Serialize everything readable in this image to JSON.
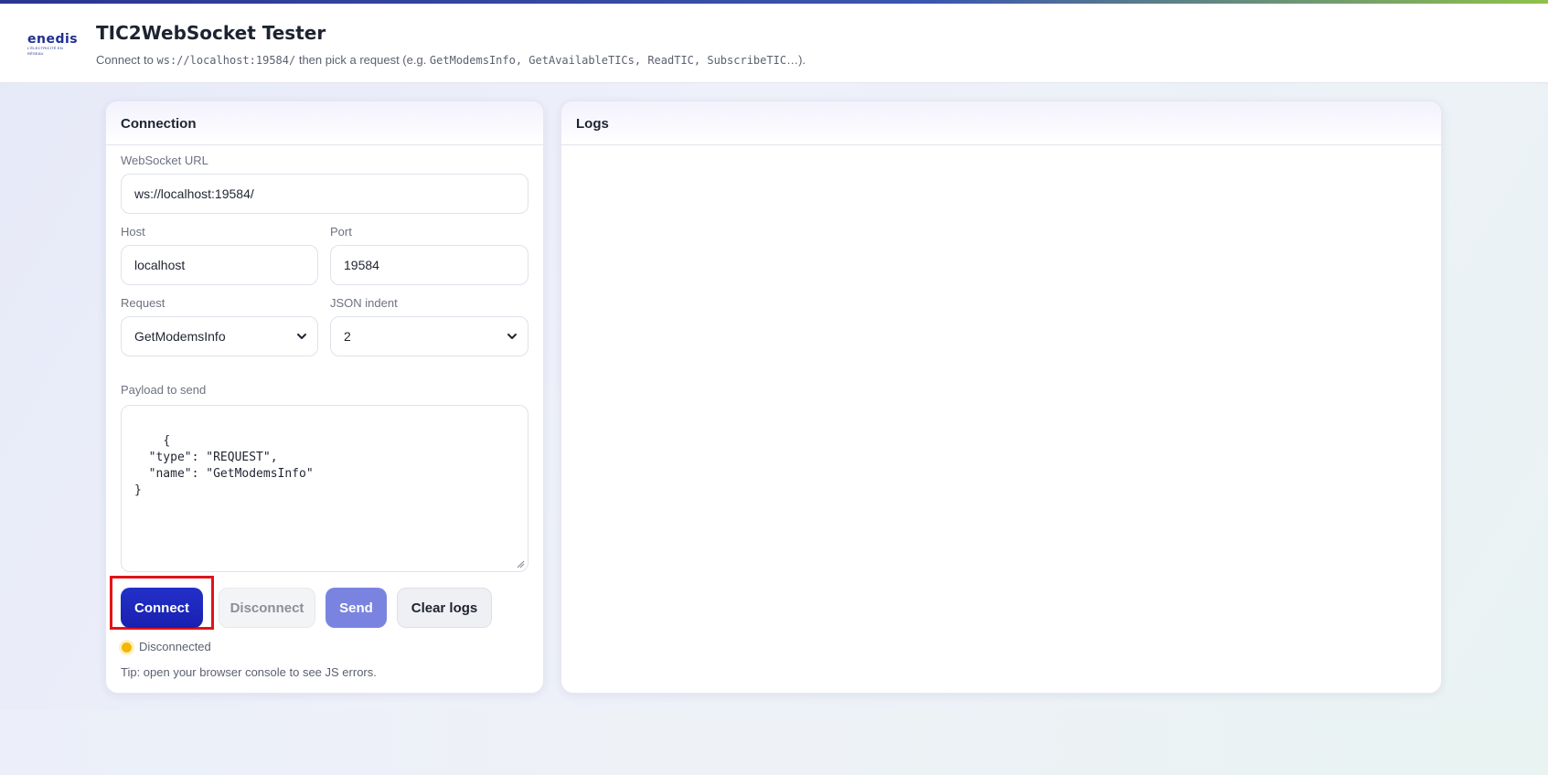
{
  "brand": {
    "logo_text": "enedis",
    "logo_tagline": "L'ÉLECTRICITÉ EN RÉSEAU"
  },
  "header": {
    "title": "TIC2WebSocket Tester",
    "subtitle_prefix": "Connect to ",
    "subtitle_url": "ws://localhost:19584/",
    "subtitle_middle": " then pick a request (e.g. ",
    "subtitle_examples": "GetModemsInfo, GetAvailableTICs, ReadTIC, SubscribeTIC",
    "subtitle_suffix": "…)."
  },
  "connection": {
    "panel_title": "Connection",
    "websocket_url_label": "WebSocket URL",
    "websocket_url_value": "ws://localhost:19584/",
    "host_label": "Host",
    "host_value": "localhost",
    "port_label": "Port",
    "port_value": "19584",
    "request_label": "Request",
    "request_selected": "GetModemsInfo",
    "json_indent_label": "JSON indent",
    "json_indent_selected": "2",
    "payload_label": "Payload to send",
    "payload_value": "{\n  \"type\": \"REQUEST\",\n  \"name\": \"GetModemsInfo\"\n}",
    "buttons": {
      "connect": "Connect",
      "disconnect": "Disconnect",
      "send": "Send",
      "clear_logs": "Clear logs"
    },
    "status_text": "Disconnected",
    "tip": "Tip: open your browser console to see JS errors."
  },
  "logs": {
    "panel_title": "Logs"
  },
  "colors": {
    "accent": "#1820b0",
    "send_button": "#7a84e0",
    "status_disconnected": "#f2b705",
    "highlight": "#e0141b"
  }
}
